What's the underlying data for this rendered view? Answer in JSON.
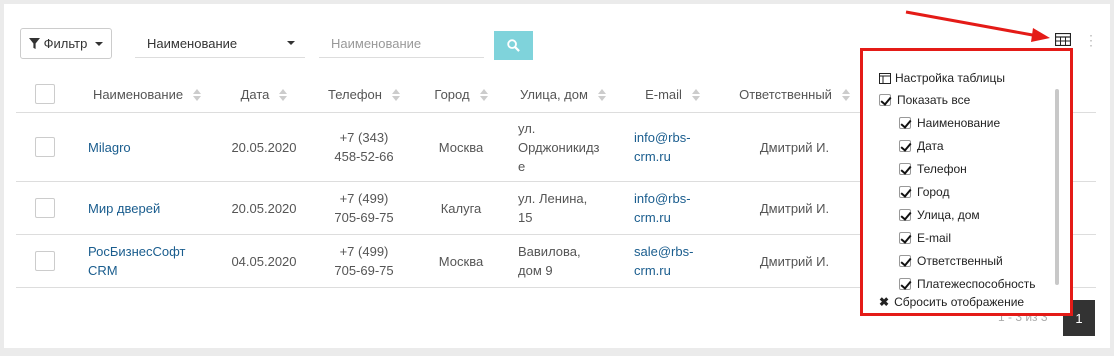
{
  "toolbar": {
    "filter_label": "Фильтр",
    "field_select_value": "Наименование",
    "search_placeholder": "Наименование"
  },
  "table": {
    "columns": [
      "Наименование",
      "Дата",
      "Телефон",
      "Город",
      "Улица, дом",
      "E-mail",
      "Ответственный"
    ],
    "rows": [
      {
        "name": "Milagro",
        "date": "20.05.2020",
        "phone1": "+7 (343)",
        "phone2": "458-52-66",
        "city": "Москва",
        "street1": "ул.",
        "street2": "Орджоникидз",
        "street3": "е",
        "email1": "info@rbs-",
        "email2": "crm.ru",
        "responsible": "Дмитрий И."
      },
      {
        "name": "Мир дверей",
        "date": "20.05.2020",
        "phone1": "+7 (499)",
        "phone2": "705-69-75",
        "city": "Калуга",
        "street1": "ул. Ленина,",
        "street2": "15",
        "email1": "info@rbs-",
        "email2": "crm.ru",
        "responsible": "Дмитрий И."
      },
      {
        "name1": "РосБизнесСофт",
        "name2": "CRM",
        "date": "04.05.2020",
        "phone1": "+7 (499)",
        "phone2": "705-69-75",
        "city": "Москва",
        "street1": "Вавилова,",
        "street2": "дом 9",
        "email1": "sale@rbs-",
        "email2": "crm.ru",
        "responsible": "Дмитрий И."
      }
    ]
  },
  "settings": {
    "title": "Настройка таблицы",
    "show_all": "Показать все",
    "items": [
      "Наименование",
      "Дата",
      "Телефон",
      "Город",
      "Улица, дом",
      "E-mail",
      "Ответственный",
      "Платежеспособность"
    ],
    "reset": "Сбросить отображение"
  },
  "pager": {
    "current": "1",
    "partial_text": "1 - 3 из 3"
  },
  "colors": {
    "accent": "#7fd3db",
    "highlight": "#e41b17",
    "link": "#1a5d8e"
  },
  "icons": [
    "filter-icon",
    "search-icon",
    "table-settings-icon",
    "kebab-menu-icon",
    "close-icon"
  ]
}
